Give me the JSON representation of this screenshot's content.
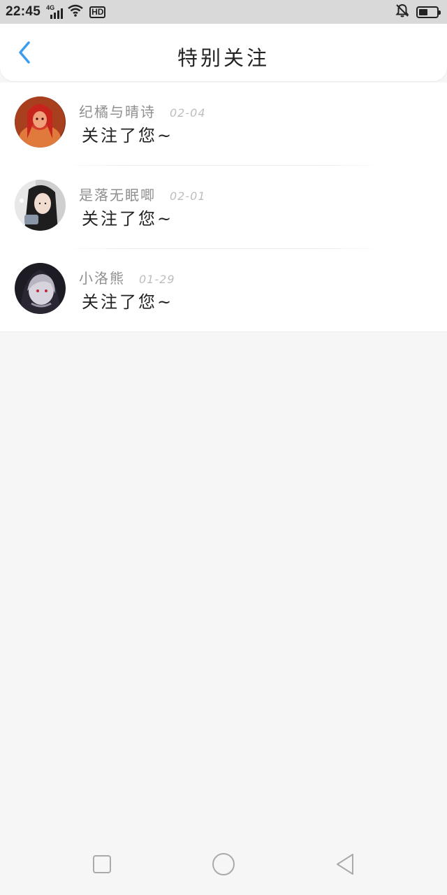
{
  "status_bar": {
    "time": "22:45",
    "network": "4G",
    "hd_badge": "HD",
    "battery_percent": 50
  },
  "header": {
    "title": "特别关注"
  },
  "items": [
    {
      "name": "纪橘与晴诗",
      "date": "02-04",
      "message": "关注了您~"
    },
    {
      "name": "是落无眠唧",
      "date": "02-01",
      "message": "关注了您~"
    },
    {
      "name": "小洛熊",
      "date": "01-29",
      "message": "关注了您~"
    }
  ],
  "colors": {
    "accent": "#3a9df0",
    "background": "#f7f6f7",
    "status_bar": "#d9d9d9"
  },
  "icons": {
    "back": "chevron-left-icon",
    "recent": "square-icon",
    "home": "circle-icon",
    "nav_back": "triangle-left-icon"
  }
}
